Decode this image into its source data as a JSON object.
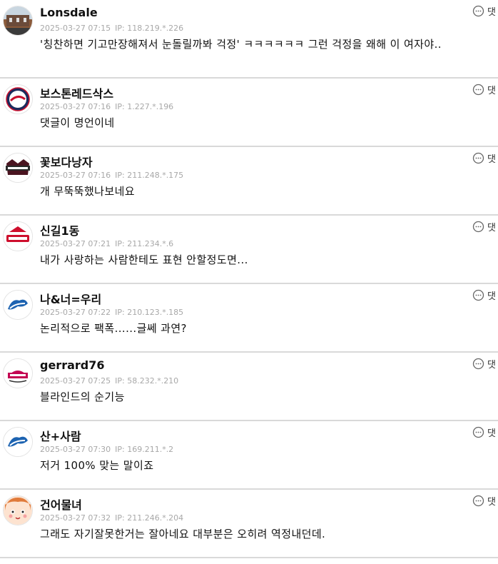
{
  "reply_label": "댓",
  "comments": [
    {
      "nick": "Lonsdale",
      "date": "2025-03-27 07:15",
      "ip": "IP: 118.219.*.226",
      "text": "'칭찬하면 기고만장해져서 눈돌릴까봐 걱정' ㅋㅋㅋㅋㅋㅋ 그런 걱정을 왜해 이 여자야..",
      "avatar": "photo-avatar"
    },
    {
      "nick": "보스톤레드삭스",
      "date": "2025-03-27 07:16",
      "ip": "IP: 1.227.*.196",
      "text": "댓글이 명언이네",
      "avatar": "twins-round-avatar"
    },
    {
      "nick": "꽃보다낭자",
      "date": "2025-03-27 07:16",
      "ip": "IP: 211.248.*.175",
      "text": "개 무뚝뚝했나보네요",
      "avatar": "champions-avatar"
    },
    {
      "nick": "신길1동",
      "date": "2025-03-27 07:21",
      "ip": "IP: 211.234.*.6",
      "text": "내가 사랑하는 사람한테도 표현 안할정도면...",
      "avatar": "landers-avatar"
    },
    {
      "nick": "나&너=우리",
      "date": "2025-03-27 07:22",
      "ip": "IP: 210.123.*.185",
      "text": "논리적으로 팩폭......글쎄 과연?",
      "avatar": "lions-avatar"
    },
    {
      "nick": "gerrard76",
      "date": "2025-03-27 07:25",
      "ip": "IP: 58.232.*.210",
      "text": "블라인드의 순기능",
      "avatar": "lg-twins-avatar"
    },
    {
      "nick": "산+사람",
      "date": "2025-03-27 07:30",
      "ip": "IP: 169.211.*.2",
      "text": "저거 100% 맞는 말이죠",
      "avatar": "lions-avatar"
    },
    {
      "nick": "건어물녀",
      "date": "2025-03-27 07:32",
      "ip": "IP: 211.246.*.204",
      "text": "그래도 자기잘못한거는 잘아네요 대부분은 오히려 역정내던데.",
      "avatar": "cartoon-girl-avatar"
    }
  ]
}
